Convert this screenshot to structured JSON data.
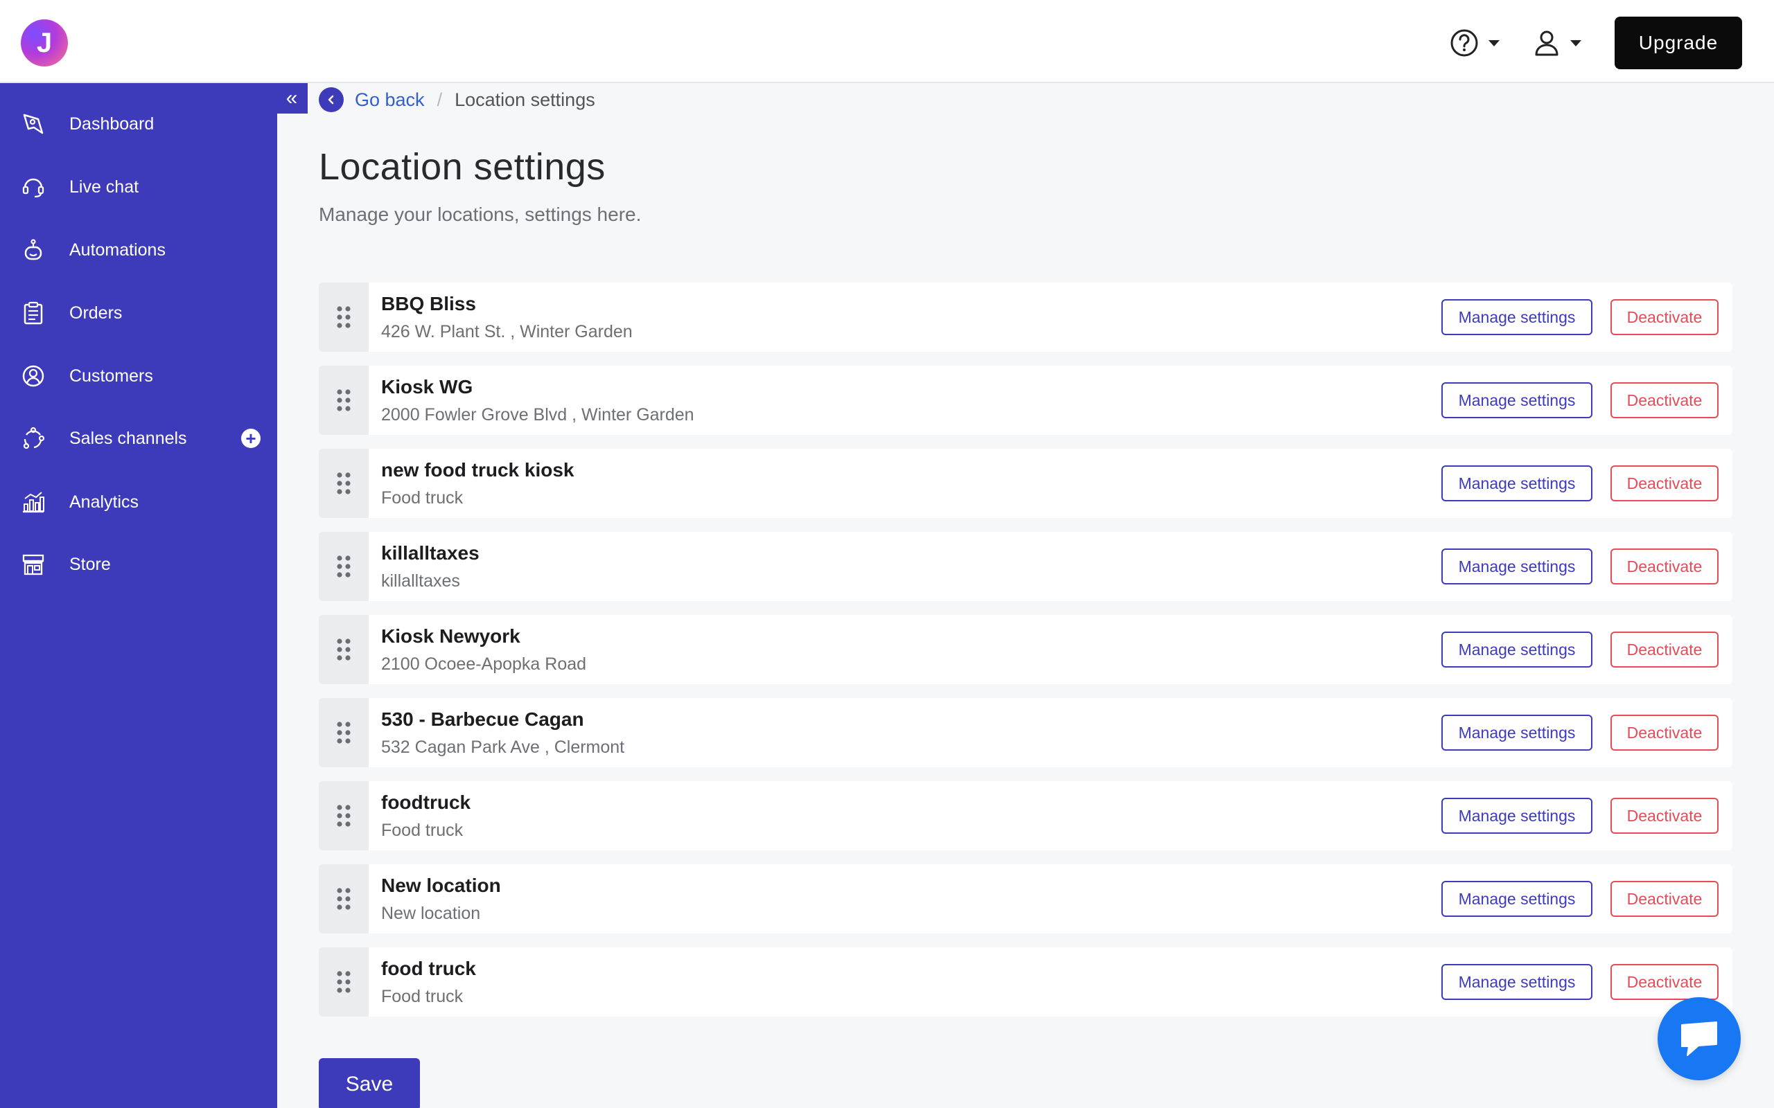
{
  "app": {
    "logo_letter": "J"
  },
  "topbar": {
    "upgrade_label": "Upgrade"
  },
  "sidebar": {
    "collapse_glyph": "«",
    "items": [
      {
        "label": "Dashboard",
        "icon": "rocket-icon"
      },
      {
        "label": "Live chat",
        "icon": "headset-icon"
      },
      {
        "label": "Automations",
        "icon": "robot-icon"
      },
      {
        "label": "Orders",
        "icon": "clipboard-icon"
      },
      {
        "label": "Customers",
        "icon": "user-circle-icon"
      },
      {
        "label": "Sales channels",
        "icon": "network-icon",
        "has_add": true
      },
      {
        "label": "Analytics",
        "icon": "bar-chart-icon"
      },
      {
        "label": "Store",
        "icon": "storefront-icon"
      }
    ]
  },
  "breadcrumb": {
    "back_label": "Go back",
    "separator": "/",
    "current": "Location settings"
  },
  "page": {
    "title": "Location settings",
    "subtitle": "Manage your locations, settings here."
  },
  "locations": [
    {
      "name": "BBQ Bliss",
      "address": "426 W. Plant St. , Winter Garden"
    },
    {
      "name": "Kiosk WG",
      "address": "2000 Fowler Grove Blvd , Winter Garden"
    },
    {
      "name": "new food truck kiosk",
      "address": "Food truck"
    },
    {
      "name": "killalltaxes",
      "address": "killalltaxes"
    },
    {
      "name": "Kiosk Newyork",
      "address": "2100 Ocoee-Apopka Road"
    },
    {
      "name": "530 - Barbecue Cagan",
      "address": "532 Cagan Park Ave , Clermont"
    },
    {
      "name": "foodtruck",
      "address": "Food truck"
    },
    {
      "name": "New location",
      "address": "New location"
    },
    {
      "name": "food truck",
      "address": "Food truck"
    }
  ],
  "actions": {
    "manage_label": "Manage settings",
    "deactivate_label": "Deactivate"
  },
  "footer": {
    "save_label": "Save"
  },
  "colors": {
    "primary": "#3d3bb9",
    "danger": "#e84b57",
    "link": "#2f5fd0",
    "chat": "#1877f2"
  }
}
